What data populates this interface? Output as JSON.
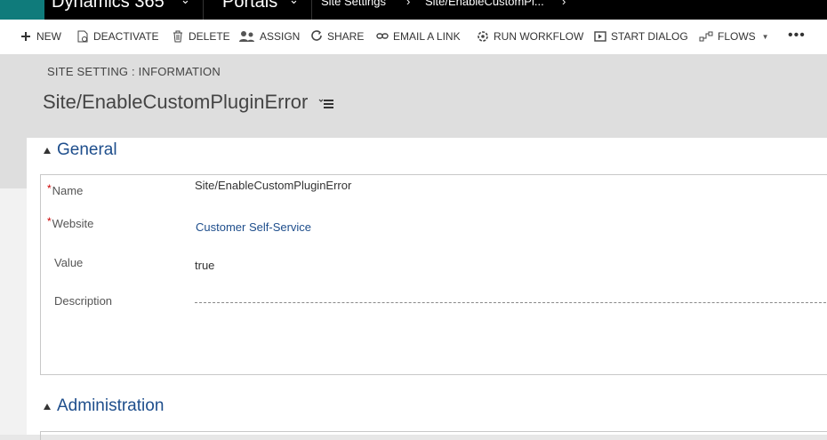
{
  "topnav": {
    "app_name": "Dynamics 365",
    "module": "Portals",
    "breadcrumb": [
      "Site Settings",
      "Site/EnableCustomPl..."
    ]
  },
  "commands": [
    {
      "label": "NEW",
      "icon": "plus-icon"
    },
    {
      "label": "DEACTIVATE",
      "icon": "deactivate-icon"
    },
    {
      "label": "DELETE",
      "icon": "trash-icon"
    },
    {
      "label": "ASSIGN",
      "icon": "assign-icon"
    },
    {
      "label": "SHARE",
      "icon": "share-icon"
    },
    {
      "label": "EMAIL A LINK",
      "icon": "link-icon"
    },
    {
      "label": "RUN WORKFLOW",
      "icon": "workflow-icon"
    },
    {
      "label": "START DIALOG",
      "icon": "dialog-icon"
    },
    {
      "label": "FLOWS",
      "icon": "flows-icon"
    }
  ],
  "more_label": "•••",
  "header": {
    "entity_label": "SITE SETTING : INFORMATION",
    "record_title": "Site/EnableCustomPluginError"
  },
  "sections": {
    "general": "General",
    "administration": "Administration"
  },
  "fields": {
    "name_label": "Name",
    "name_value": "Site/EnableCustomPluginError",
    "website_label": "Website",
    "website_value": "Customer Self-Service",
    "value_label": "Value",
    "value_value": "true",
    "description_label": "Description",
    "required_mark": "*"
  },
  "colors": {
    "accent_teal": "#0f7b7b",
    "link_blue": "#1e4e8c",
    "required_red": "#cc0000"
  }
}
